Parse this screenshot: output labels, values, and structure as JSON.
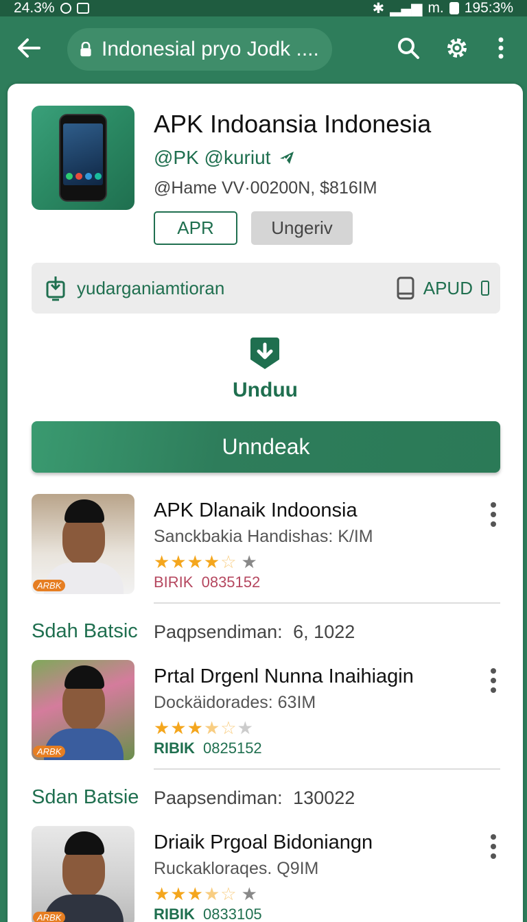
{
  "status_bar": {
    "left_text": "24.3%",
    "right_mid": "m.",
    "right_text": "195:3%"
  },
  "toolbar": {
    "url_text": "Indonesial pryo Jodk ...."
  },
  "app": {
    "title": "APK Indoansia Indonesia",
    "developer": "@PK @kuriut",
    "meta": "@Hame VV·00200N, $816IM",
    "chip_outline": "APR",
    "chip_gray": "Ungeriv"
  },
  "info_bar": {
    "text": "yudarganiamtioran",
    "right_label": "APUD"
  },
  "download": {
    "label": "Unduu",
    "button_label": "Unndeak"
  },
  "items": [
    {
      "title": "APK Dlanaik Indoonsia",
      "subtitle": "Sanckbakia Handishas: K/IM",
      "rating": 4.5,
      "code_prefix": "BIRIK",
      "code": "0835152",
      "badge": "ARBK",
      "prefix_color": "#b5475f"
    },
    {
      "title": "Prtal Drgenl Nunna Inaihiagin",
      "subtitle": "Dockäidorades: 63IM",
      "rating": 3.5,
      "code_prefix": "RIBIK",
      "code": "0825152",
      "badge": "ARBK",
      "prefix_color": "#1f6f4f"
    },
    {
      "title": "Driaik Prgoal Bidoniangn",
      "subtitle": "Ruckakloraqes. Q9IM",
      "rating": 3.5,
      "code_prefix": "RIBIK",
      "code": "0833105",
      "badge": "ARBK",
      "prefix_color": "#1f6f4f"
    }
  ],
  "sections": [
    {
      "title": "Sdah Batsic",
      "label": "Paqpsendiman:",
      "value": "6, 1022"
    },
    {
      "title": "Sdan Batsie",
      "label": "Paapsendiman:",
      "value": "130022"
    }
  ],
  "colors": {
    "brand": "#2e7d5b",
    "brand_dark": "#1f6f4f",
    "star": "#f4a61d"
  }
}
